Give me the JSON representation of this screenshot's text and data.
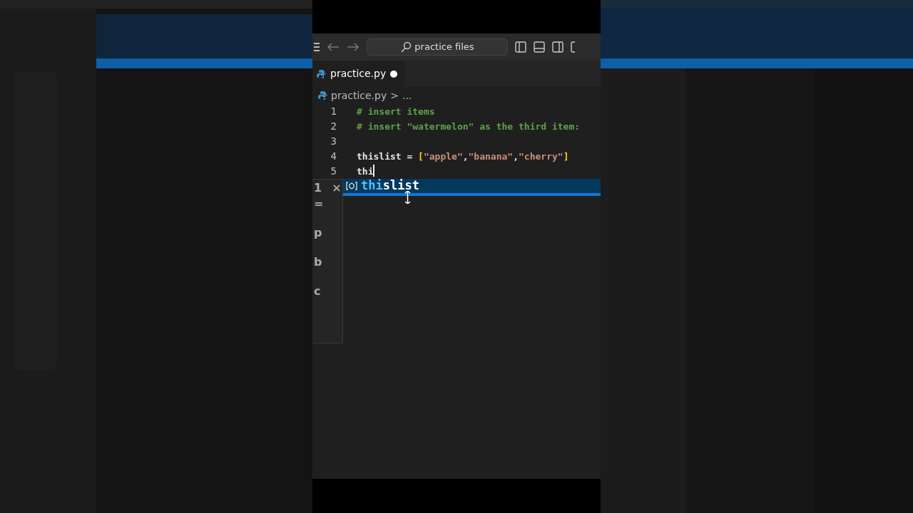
{
  "title_bar": {
    "search": "practice files"
  },
  "tabs": [
    {
      "label": "practice.py",
      "modified": true,
      "selected": true
    }
  ],
  "breadcrumb": {
    "file": "practice.py",
    "separator": ">",
    "rest": "..."
  },
  "code_lines": [
    {
      "number": "1",
      "tokens": [
        {
          "text": "# insert items",
          "kind": "comment"
        }
      ]
    },
    {
      "number": "2",
      "tokens": [
        {
          "text": "# insert \"watermelon\" as the third item:",
          "kind": "comment"
        }
      ]
    },
    {
      "number": "3"
    },
    {
      "number": "4",
      "tokens": [
        {
          "text": "thislist = ",
          "kind": "plain"
        },
        {
          "text": "[",
          "kind": "bracket"
        },
        {
          "text": "\"apple\"",
          "kind": "string"
        },
        {
          "text": ",",
          "kind": "plain"
        },
        {
          "text": "\"banana\"",
          "kind": "string"
        },
        {
          "text": ",",
          "kind": "plain"
        },
        {
          "text": "\"cherry\"",
          "kind": "string"
        },
        {
          "text": "]",
          "kind": "bracket"
        }
      ]
    },
    {
      "number": "5",
      "tokens": [
        {
          "text": "thi",
          "kind": "plain"
        }
      ],
      "cursor": true
    }
  ],
  "side_panel": {
    "rows": [
      [
        "1",
        "×"
      ],
      [
        "="
      ],
      [
        "p"
      ],
      [
        "b"
      ],
      [
        "c"
      ]
    ]
  },
  "suggestions": [
    {
      "typed": "thi",
      "rest": "slist",
      "selected": true
    }
  ]
}
